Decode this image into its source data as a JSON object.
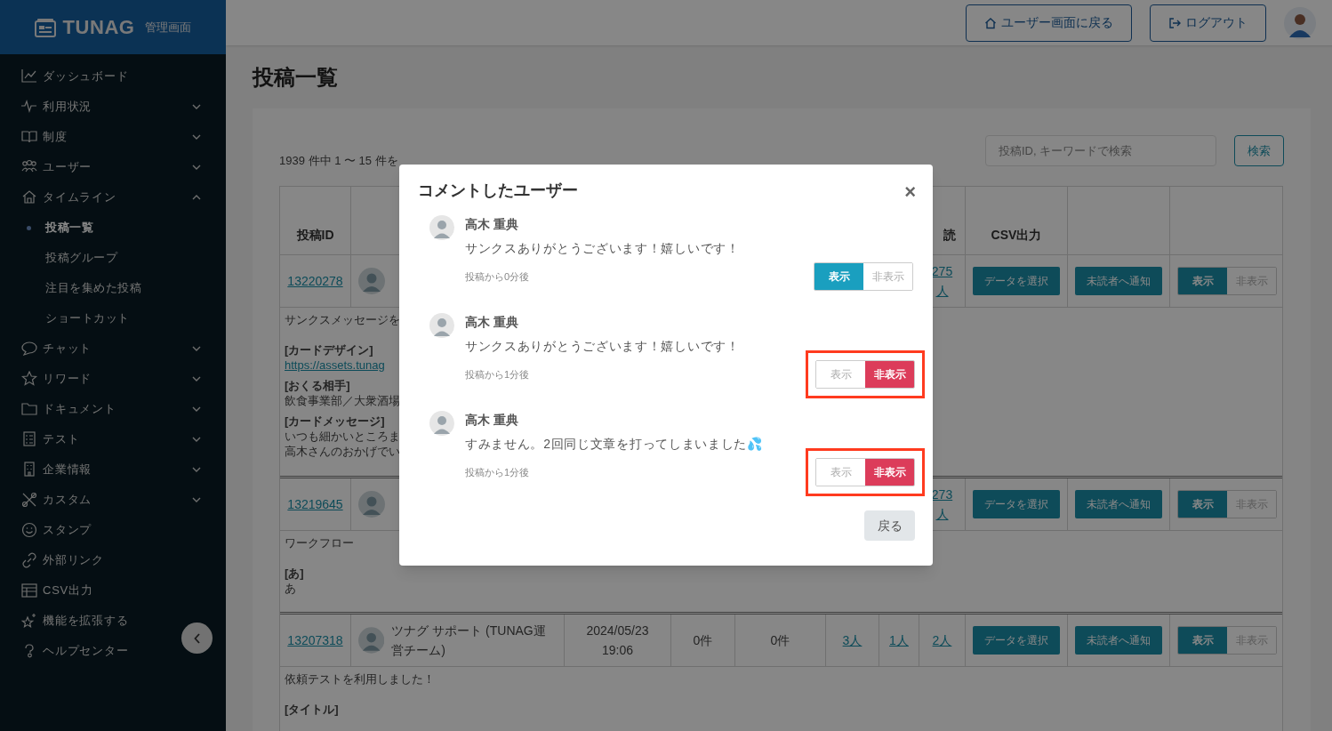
{
  "brand": {
    "logo": "TUNAG",
    "subtitle": "管理画面"
  },
  "sidebar": {
    "items": [
      {
        "label": "ダッシュボード",
        "kind": "link"
      },
      {
        "label": "利用状況",
        "kind": "group",
        "expanded": false
      },
      {
        "label": "制度",
        "kind": "group",
        "expanded": false
      },
      {
        "label": "ユーザー",
        "kind": "group",
        "expanded": false
      },
      {
        "label": "タイムライン",
        "kind": "group",
        "expanded": true,
        "children": [
          {
            "label": "投稿一覧",
            "selected": true
          },
          {
            "label": "投稿グループ",
            "selected": false
          },
          {
            "label": "注目を集めた投稿",
            "selected": false
          },
          {
            "label": "ショートカット",
            "selected": false
          }
        ]
      },
      {
        "label": "チャット",
        "kind": "group",
        "expanded": false
      },
      {
        "label": "リワード",
        "kind": "group",
        "expanded": false
      },
      {
        "label": "ドキュメント",
        "kind": "group",
        "expanded": false
      },
      {
        "label": "テスト",
        "kind": "group",
        "expanded": false
      },
      {
        "label": "企業情報",
        "kind": "group",
        "expanded": false
      },
      {
        "label": "カスタム",
        "kind": "group",
        "expanded": false
      },
      {
        "label": "スタンプ",
        "kind": "link"
      },
      {
        "label": "外部リンク",
        "kind": "link"
      },
      {
        "label": "CSV出力",
        "kind": "link"
      },
      {
        "label": "機能を拡張する",
        "kind": "link"
      },
      {
        "label": "ヘルプセンター",
        "kind": "link"
      }
    ]
  },
  "header": {
    "buttons": [
      {
        "label": "ユーザー画面に戻る"
      },
      {
        "label": "ログアウト"
      }
    ]
  },
  "page_title": "投稿一覧",
  "result_count": "1939 件中 1 〜 15 件を",
  "search": {
    "placeholder": "投稿ID, キーワードで検索",
    "button": "検索"
  },
  "table": {
    "columns": [
      "投稿ID",
      "読",
      "CSV出力"
    ],
    "rows": [
      {
        "post_id": "13220278",
        "unread": "275人",
        "actions": [
          "データを選択",
          "未読者へ通知"
        ],
        "visibility": [
          {
            "label": "表示",
            "selected": true
          },
          {
            "label": "非表示",
            "selected": false
          }
        ],
        "body": [
          {
            "kind": "text",
            "text": "サンクスメッセージを"
          },
          {
            "kind": "heading",
            "text": "[カードデザイン]"
          },
          {
            "kind": "link",
            "text": "https://assets.tunag"
          },
          {
            "kind": "heading",
            "text": "[おくる相手]"
          },
          {
            "kind": "text",
            "text": "飲食事業部／大衆酒場"
          },
          {
            "kind": "heading",
            "text": "[カードメッセージ]"
          },
          {
            "kind": "text",
            "text": "いつも細かいところま"
          },
          {
            "kind": "text",
            "text": "高木さんのおかげでい"
          }
        ]
      },
      {
        "post_id": "13219645",
        "unread": "273人",
        "actions": [
          "データを選択",
          "未読者へ通知"
        ],
        "visibility": [
          {
            "label": "表示",
            "selected": true
          },
          {
            "label": "非表示",
            "selected": false
          }
        ],
        "body": [
          {
            "kind": "text",
            "text": "ワークフロー"
          },
          {
            "kind": "heading",
            "text": "[あ]"
          },
          {
            "kind": "text",
            "text": "あ"
          }
        ]
      },
      {
        "post_id": "13207318",
        "author": "ツナグ サポート (TUNAG運営チーム)",
        "date": "2024/05/23 19:06",
        "comments": "0件",
        "reactions": "0件",
        "column_6": "3人",
        "column_7": "1人",
        "unread": "2人",
        "actions": [
          "データを選択",
          "未読者へ通知"
        ],
        "visibility": [
          {
            "label": "表示",
            "selected": true
          },
          {
            "label": "非表示",
            "selected": false
          }
        ],
        "body": [
          {
            "kind": "text",
            "text": "依頼テストを利用しました！"
          },
          {
            "kind": "heading",
            "text": "[タイトル]"
          }
        ]
      }
    ]
  },
  "modal": {
    "title": "コメントしたユーザー",
    "close": "×",
    "back_button": "戻る",
    "comments": [
      {
        "name": "高木 重典",
        "text": "サンクスありがとうございます！嬉しいです！",
        "time": "投稿から0分後",
        "highlighted": false,
        "visibility": [
          {
            "label": "表示",
            "selected": true
          },
          {
            "label": "非表示",
            "selected": false
          }
        ]
      },
      {
        "name": "高木 重典",
        "text": "サンクスありがとうございます！嬉しいです！",
        "time": "投稿から1分後",
        "highlighted": true,
        "visibility": [
          {
            "label": "表示",
            "selected": false
          },
          {
            "label": "非表示",
            "selected": true
          }
        ]
      },
      {
        "name": "高木 重典",
        "text": "すみません。2回同じ文章を打ってしまいました💦",
        "time": "投稿から1分後",
        "highlighted": true,
        "visibility": [
          {
            "label": "表示",
            "selected": false
          },
          {
            "label": "非表示",
            "selected": true
          }
        ]
      }
    ]
  }
}
